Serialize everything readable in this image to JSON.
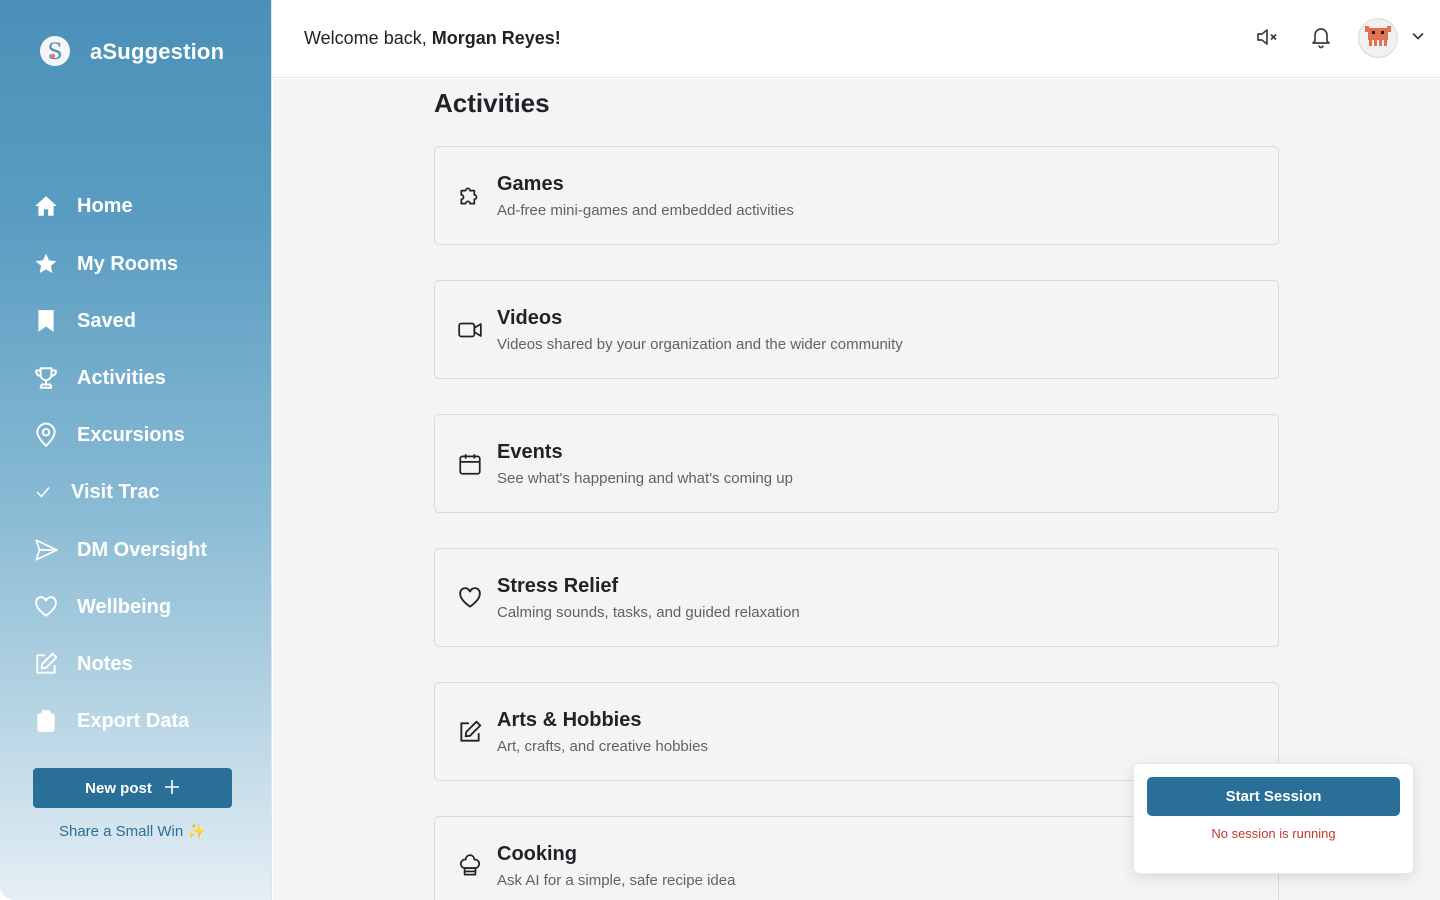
{
  "app": {
    "name": "aSuggestion"
  },
  "header": {
    "welcome_prefix": "Welcome back, ",
    "user_name": "Morgan Reyes!"
  },
  "sidebar": {
    "items": [
      {
        "label": "Home",
        "icon": "home-icon"
      },
      {
        "label": "My Rooms",
        "icon": "star-icon"
      },
      {
        "label": "Saved",
        "icon": "bookmark-icon"
      },
      {
        "label": "Activities",
        "icon": "trophy-icon"
      },
      {
        "label": "Excursions",
        "icon": "map-pin-icon"
      },
      {
        "label": "Visit Trac",
        "icon": "check-icon"
      },
      {
        "label": "DM Oversight",
        "icon": "send-icon"
      },
      {
        "label": "Wellbeing",
        "icon": "heart-icon"
      },
      {
        "label": "Notes",
        "icon": "edit-icon"
      },
      {
        "label": "Export Data",
        "icon": "clipboard-icon"
      }
    ],
    "new_post_label": "New post",
    "small_win_label": "Share a Small Win ✨"
  },
  "main": {
    "title": "Activities",
    "cards": [
      {
        "title": "Games",
        "description": "Ad-free mini-games and embedded activities",
        "icon": "puzzle-icon"
      },
      {
        "title": "Videos",
        "description": "Videos shared by your organization and the wider community",
        "icon": "video-icon"
      },
      {
        "title": "Events",
        "description": "See what's happening and what's coming up",
        "icon": "calendar-icon"
      },
      {
        "title": "Stress Relief",
        "description": "Calming sounds, tasks, and guided relaxation",
        "icon": "heart-icon"
      },
      {
        "title": "Arts & Hobbies",
        "description": "Art, crafts, and creative hobbies",
        "icon": "pencil-icon"
      },
      {
        "title": "Cooking",
        "description": "Ask AI for a simple, safe recipe idea",
        "icon": "chef-hat-icon"
      }
    ]
  },
  "session": {
    "start_label": "Start Session",
    "status": "No session is running"
  },
  "colors": {
    "primary": "#2a6f97",
    "sidebar_top": "#4a90b8",
    "status_text": "#c0392b",
    "background": "#f4f4f4"
  }
}
